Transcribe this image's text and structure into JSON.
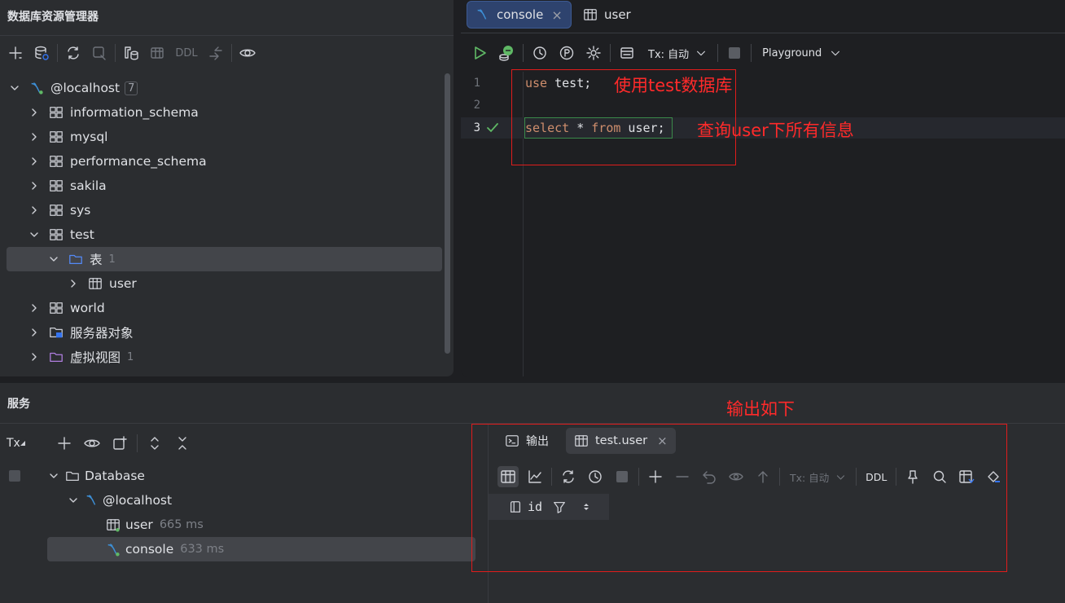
{
  "explorer": {
    "title": "数据库资源管理器",
    "toolbar": {
      "ddl_label": "DDL"
    },
    "host": {
      "label": "@localhost",
      "count": "7"
    },
    "schemas": [
      {
        "label": "information_schema"
      },
      {
        "label": "mysql"
      },
      {
        "label": "performance_schema"
      },
      {
        "label": "sakila"
      },
      {
        "label": "sys"
      },
      {
        "label": "test"
      }
    ],
    "tables_folder": {
      "label": "表",
      "count": "1"
    },
    "table_user": {
      "label": "user"
    },
    "world": {
      "label": "world"
    },
    "server_objects": {
      "label": "服务器对象"
    },
    "virtual_views": {
      "label": "虚拟视图",
      "count": "1"
    }
  },
  "editor": {
    "tabs": [
      {
        "label": "console",
        "close": "×"
      },
      {
        "label": "user"
      }
    ],
    "toolbar": {
      "tx_label": "Tx: 自动",
      "playground_label": "Playground"
    },
    "lines": [
      {
        "num": "1",
        "kw": "use",
        "rest": " test;"
      },
      {
        "num": "2"
      },
      {
        "num": "3",
        "kw1": "select",
        "mid": " * ",
        "kw2": "from",
        "rest": " user",
        "semi": ";"
      }
    ],
    "annotations": {
      "line1": "使用test数据库",
      "line3": "查询user下所有信息"
    }
  },
  "services": {
    "title": "服务",
    "tx_label": "Tx",
    "tree": {
      "database": "Database",
      "host": "@localhost",
      "user": {
        "label": "user",
        "time": "665 ms"
      },
      "console": {
        "label": "console",
        "time": "633 ms"
      }
    },
    "output_annotation": "输出如下",
    "result_tabs": [
      {
        "label": "输出"
      },
      {
        "label": "test.user",
        "close": "×"
      }
    ],
    "result_toolbar": {
      "tx_label": "Tx: 自动",
      "ddl_label": "DDL"
    },
    "columns": [
      {
        "label": "id"
      }
    ]
  },
  "colors": {
    "accent_blue": "#3574f0",
    "annotation_red": "#ff2a2a",
    "run_green": "#5fb865",
    "keyword": "#cf8e6d"
  }
}
